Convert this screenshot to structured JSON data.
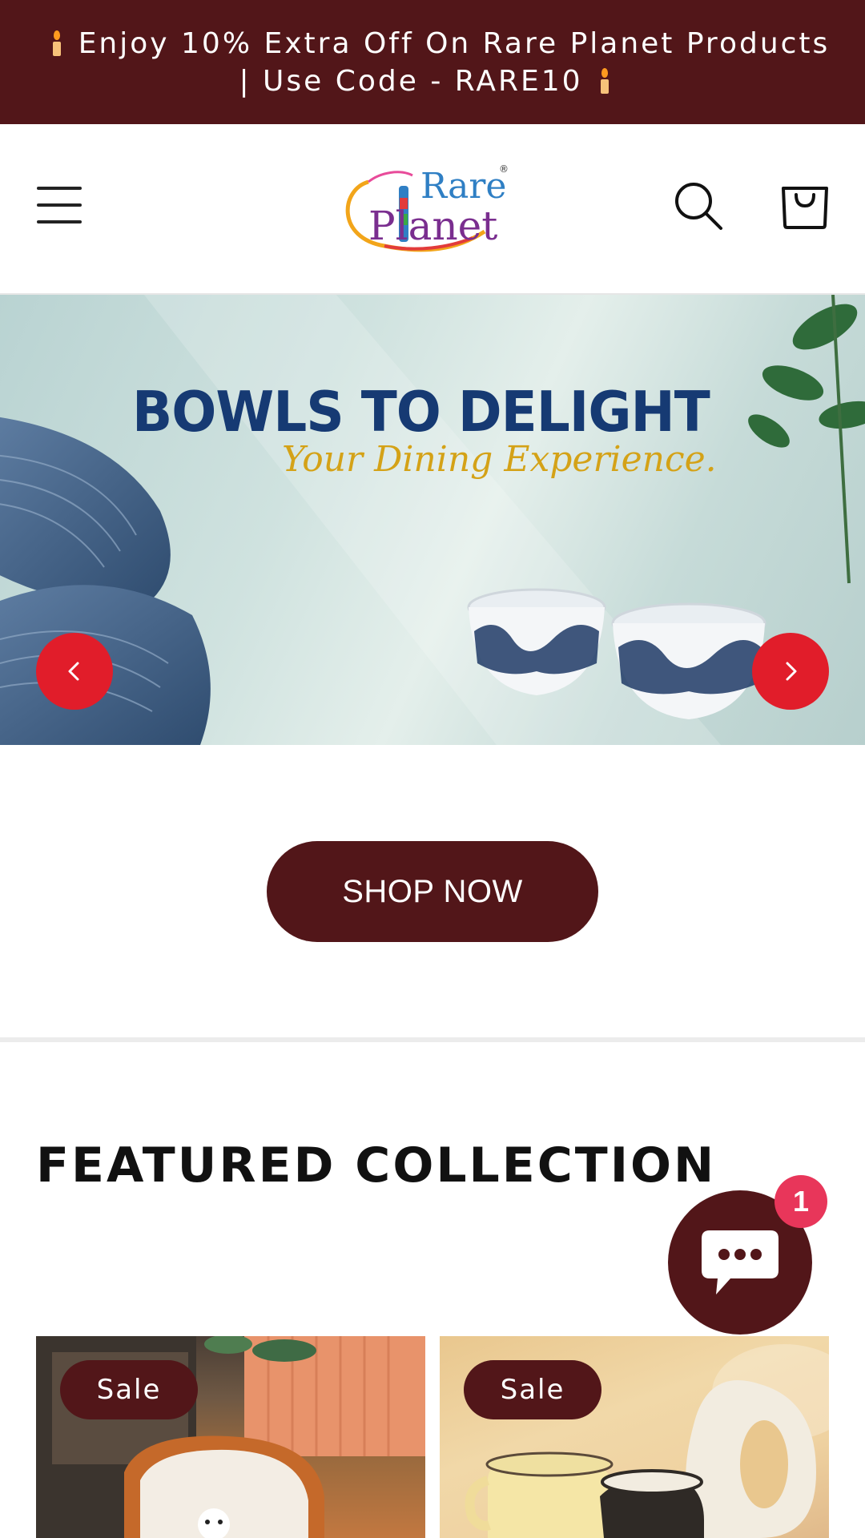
{
  "announcement": {
    "text": "Enjoy 10% Extra Off On Rare Planet Products | Use Code - RARE10",
    "icon": "candle-icon"
  },
  "header": {
    "logo_text_1": "Rare",
    "logo_text_2": "Planet",
    "logo_mark": "®",
    "menu_icon": "hamburger-menu-icon",
    "search_icon": "search-icon",
    "cart_icon": "shopping-bag-icon"
  },
  "hero": {
    "title": "BOWLS TO DELIGHT",
    "subtitle": "Your Dining Experience.",
    "prev_icon": "chevron-left-icon",
    "next_icon": "chevron-right-icon"
  },
  "cta": {
    "shop_now_label": "SHOP NOW"
  },
  "featured": {
    "title": "FEATURED COLLECTION",
    "products": [
      {
        "badge": "Sale"
      },
      {
        "badge": "Sale"
      }
    ]
  },
  "chat": {
    "icon": "chat-bubble-icon",
    "badge_count": "1"
  },
  "colors": {
    "brand_maroon": "#521619",
    "slider_red": "#e11d2a",
    "badge_pink": "#e8365a",
    "hero_title_blue": "#163a73",
    "hero_sub_gold": "#d4a217"
  }
}
